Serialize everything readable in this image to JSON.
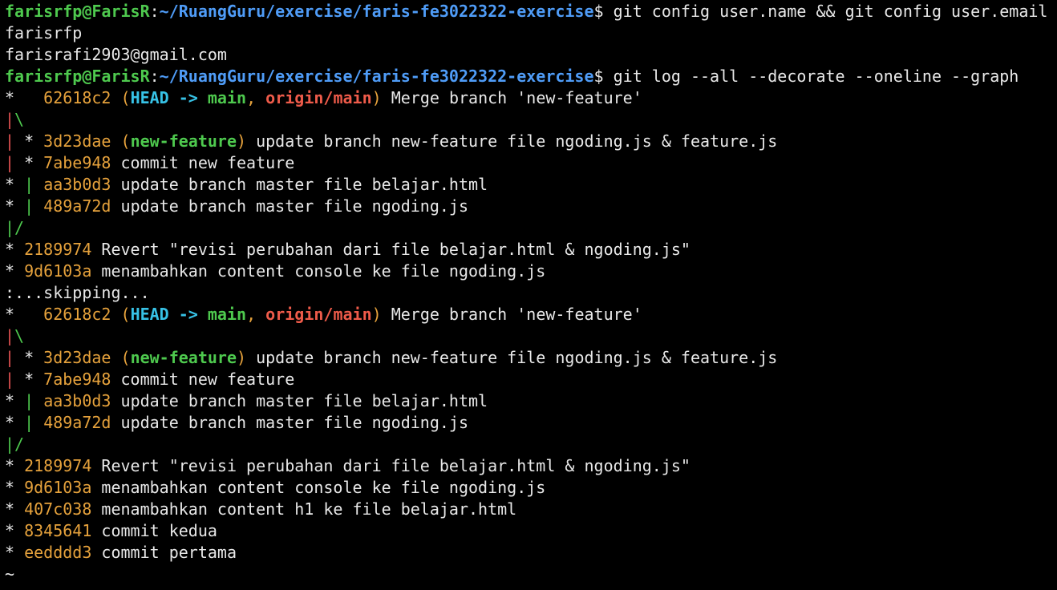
{
  "colors": {
    "background": "#000000",
    "text": "#e8e8e8",
    "user": "#4ec94e",
    "path": "#4f9cf7",
    "hash": "#e6a23c",
    "head": "#37c2e6",
    "local_branch": "#4ec94e",
    "remote_branch": "#ee5b4a",
    "graph_red": "#e45353",
    "graph_green": "#4ec94e"
  },
  "terminal": {
    "lines": [
      [
        {
          "t": "farisrfp@FarisR",
          "c": "user"
        },
        {
          "t": ":",
          "c": "plain"
        },
        {
          "t": "~/RuangGuru/exercise/faris-fe3022322-exercise",
          "c": "path"
        },
        {
          "t": "$ git config user.name && git config user.email",
          "c": "plain"
        }
      ],
      [
        {
          "t": "farisrfp",
          "c": "plain"
        }
      ],
      [
        {
          "t": "farisrafi2903@gmail.com",
          "c": "plain"
        }
      ],
      [
        {
          "t": "farisrfp@FarisR",
          "c": "user"
        },
        {
          "t": ":",
          "c": "plain"
        },
        {
          "t": "~/RuangGuru/exercise/faris-fe3022322-exercise",
          "c": "path"
        },
        {
          "t": "$ git log --all --decorate --oneline --graph",
          "c": "plain"
        }
      ],
      [
        {
          "t": "*   ",
          "c": "plain"
        },
        {
          "t": "62618c2",
          "c": "hash"
        },
        {
          "t": " (",
          "c": "hash"
        },
        {
          "t": "HEAD -> ",
          "c": "head"
        },
        {
          "t": "main",
          "c": "branch"
        },
        {
          "t": ", ",
          "c": "hash"
        },
        {
          "t": "origin/main",
          "c": "remote"
        },
        {
          "t": ")",
          "c": "hash"
        },
        {
          "t": " Merge branch 'new-feature'",
          "c": "plain"
        }
      ],
      [
        {
          "t": "|",
          "c": "gr"
        },
        {
          "t": "\\",
          "c": "gg"
        }
      ],
      [
        {
          "t": "|",
          "c": "gr"
        },
        {
          "t": " * ",
          "c": "plain"
        },
        {
          "t": "3d23dae",
          "c": "hash"
        },
        {
          "t": " (",
          "c": "hash"
        },
        {
          "t": "new-feature",
          "c": "branch"
        },
        {
          "t": ")",
          "c": "hash"
        },
        {
          "t": " update branch new-feature file ngoding.js & feature.js",
          "c": "plain"
        }
      ],
      [
        {
          "t": "|",
          "c": "gr"
        },
        {
          "t": " * ",
          "c": "plain"
        },
        {
          "t": "7abe948",
          "c": "hash"
        },
        {
          "t": " commit new feature",
          "c": "plain"
        }
      ],
      [
        {
          "t": "* ",
          "c": "plain"
        },
        {
          "t": "|",
          "c": "gg"
        },
        {
          "t": " ",
          "c": "plain"
        },
        {
          "t": "aa3b0d3",
          "c": "hash"
        },
        {
          "t": " update branch master file belajar.html",
          "c": "plain"
        }
      ],
      [
        {
          "t": "* ",
          "c": "plain"
        },
        {
          "t": "|",
          "c": "gg"
        },
        {
          "t": " ",
          "c": "plain"
        },
        {
          "t": "489a72d",
          "c": "hash"
        },
        {
          "t": " update branch master file ngoding.js",
          "c": "plain"
        }
      ],
      [
        {
          "t": "|/",
          "c": "gg"
        }
      ],
      [
        {
          "t": "* ",
          "c": "plain"
        },
        {
          "t": "2189974",
          "c": "hash"
        },
        {
          "t": " Revert \"revisi perubahan dari file belajar.html & ngoding.js\"",
          "c": "plain"
        }
      ],
      [
        {
          "t": "* ",
          "c": "plain"
        },
        {
          "t": "9d6103a",
          "c": "hash"
        },
        {
          "t": " menambahkan content console ke file ngoding.js",
          "c": "plain"
        }
      ],
      [
        {
          "t": ":...skipping...",
          "c": "plain"
        }
      ],
      [
        {
          "t": "*   ",
          "c": "plain"
        },
        {
          "t": "62618c2",
          "c": "hash"
        },
        {
          "t": " (",
          "c": "hash"
        },
        {
          "t": "HEAD -> ",
          "c": "head"
        },
        {
          "t": "main",
          "c": "branch"
        },
        {
          "t": ", ",
          "c": "hash"
        },
        {
          "t": "origin/main",
          "c": "remote"
        },
        {
          "t": ")",
          "c": "hash"
        },
        {
          "t": " Merge branch 'new-feature'",
          "c": "plain"
        }
      ],
      [
        {
          "t": "|",
          "c": "gr"
        },
        {
          "t": "\\",
          "c": "gg"
        }
      ],
      [
        {
          "t": "|",
          "c": "gr"
        },
        {
          "t": " * ",
          "c": "plain"
        },
        {
          "t": "3d23dae",
          "c": "hash"
        },
        {
          "t": " (",
          "c": "hash"
        },
        {
          "t": "new-feature",
          "c": "branch"
        },
        {
          "t": ")",
          "c": "hash"
        },
        {
          "t": " update branch new-feature file ngoding.js & feature.js",
          "c": "plain"
        }
      ],
      [
        {
          "t": "|",
          "c": "gr"
        },
        {
          "t": " * ",
          "c": "plain"
        },
        {
          "t": "7abe948",
          "c": "hash"
        },
        {
          "t": " commit new feature",
          "c": "plain"
        }
      ],
      [
        {
          "t": "* ",
          "c": "plain"
        },
        {
          "t": "|",
          "c": "gg"
        },
        {
          "t": " ",
          "c": "plain"
        },
        {
          "t": "aa3b0d3",
          "c": "hash"
        },
        {
          "t": " update branch master file belajar.html",
          "c": "plain"
        }
      ],
      [
        {
          "t": "* ",
          "c": "plain"
        },
        {
          "t": "|",
          "c": "gg"
        },
        {
          "t": " ",
          "c": "plain"
        },
        {
          "t": "489a72d",
          "c": "hash"
        },
        {
          "t": " update branch master file ngoding.js",
          "c": "plain"
        }
      ],
      [
        {
          "t": "|/",
          "c": "gg"
        }
      ],
      [
        {
          "t": "* ",
          "c": "plain"
        },
        {
          "t": "2189974",
          "c": "hash"
        },
        {
          "t": " Revert \"revisi perubahan dari file belajar.html & ngoding.js\"",
          "c": "plain"
        }
      ],
      [
        {
          "t": "* ",
          "c": "plain"
        },
        {
          "t": "9d6103a",
          "c": "hash"
        },
        {
          "t": " menambahkan content console ke file ngoding.js",
          "c": "plain"
        }
      ],
      [
        {
          "t": "* ",
          "c": "plain"
        },
        {
          "t": "407c038",
          "c": "hash"
        },
        {
          "t": " menambahkan content h1 ke file belajar.html",
          "c": "plain"
        }
      ],
      [
        {
          "t": "* ",
          "c": "plain"
        },
        {
          "t": "8345641",
          "c": "hash"
        },
        {
          "t": " commit kedua",
          "c": "plain"
        }
      ],
      [
        {
          "t": "* ",
          "c": "plain"
        },
        {
          "t": "eedddd3",
          "c": "hash"
        },
        {
          "t": " commit pertama",
          "c": "plain"
        }
      ],
      [
        {
          "t": "~",
          "c": "plain"
        }
      ]
    ]
  }
}
